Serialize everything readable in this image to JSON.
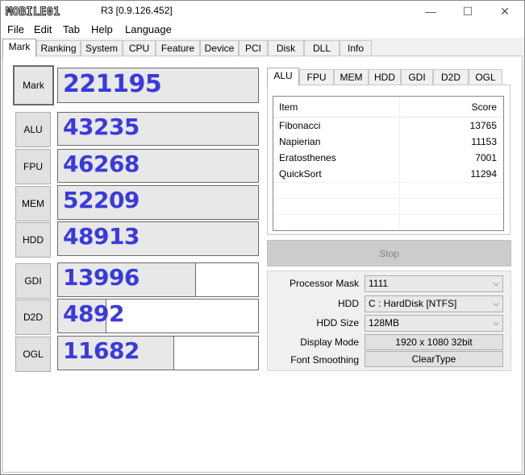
{
  "window": {
    "title": "R3 [0.9.126.452]",
    "logo_text": "MOBILE01",
    "min_glyph": "—",
    "max_glyph": "☐",
    "close_glyph": "✕"
  },
  "menu": [
    "File",
    "Edit",
    "Tab",
    "Help",
    "Language"
  ],
  "tabs": [
    "Mark",
    "Ranking",
    "System",
    "CPU",
    "Feature",
    "Device",
    "PCI",
    "Disk",
    "DLL",
    "Info"
  ],
  "active_tab": "Mark",
  "scores": [
    {
      "label": "Mark",
      "value": "221195",
      "fill": 1.0
    },
    {
      "label": "ALU",
      "value": "43235",
      "fill": 1.0
    },
    {
      "label": "FPU",
      "value": "46268",
      "fill": 1.0
    },
    {
      "label": "MEM",
      "value": "52209",
      "fill": 1.0
    },
    {
      "label": "HDD",
      "value": "48913",
      "fill": 1.0
    },
    {
      "label": "GDI",
      "value": "13996",
      "fill": 0.69
    },
    {
      "label": "D2D",
      "value": "4892",
      "fill": 0.24
    },
    {
      "label": "OGL",
      "value": "11682",
      "fill": 0.58
    }
  ],
  "detail_tabs": [
    "ALU",
    "FPU",
    "MEM",
    "HDD",
    "GDI",
    "D2D",
    "OGL"
  ],
  "active_detail_tab": "ALU",
  "list": {
    "headers": {
      "item": "Item",
      "score": "Score"
    },
    "rows": [
      {
        "name": "Fibonacci",
        "score": "13765"
      },
      {
        "name": "Napierian",
        "score": "11153"
      },
      {
        "name": "Eratosthenes",
        "score": "7001"
      },
      {
        "name": "QuickSort",
        "score": "11294"
      }
    ]
  },
  "stop_label": "Stop",
  "settings": {
    "processor_mask": {
      "label": "Processor Mask",
      "value": "1111"
    },
    "hdd": {
      "label": "HDD",
      "value": "C : HardDisk [NTFS]"
    },
    "hdd_size": {
      "label": "HDD Size",
      "value": "128MB"
    },
    "display_mode": {
      "label": "Display Mode",
      "value": "1920 x 1080 32bit"
    },
    "font_smoothing": {
      "label": "Font Smoothing",
      "value": "ClearType"
    }
  }
}
